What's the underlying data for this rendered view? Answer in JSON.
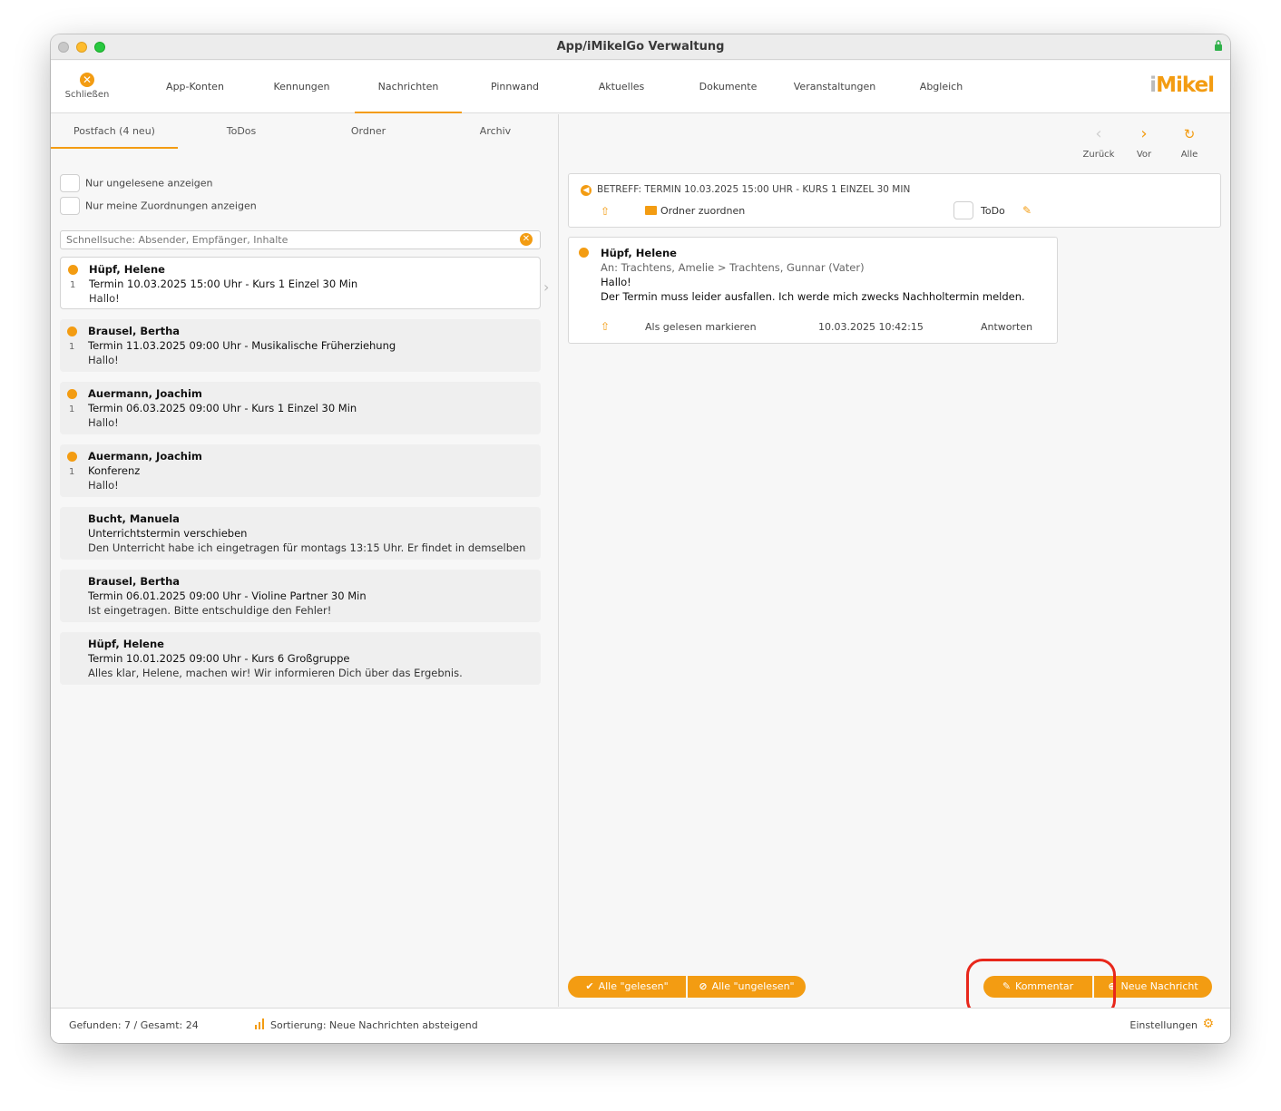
{
  "window": {
    "title": "App/iMikelGo Verwaltung"
  },
  "toolbar": {
    "close_label": "Schließen",
    "tabs": [
      {
        "label": "App-Konten"
      },
      {
        "label": "Kennungen"
      },
      {
        "label": "Nachrichten",
        "active": true
      },
      {
        "label": "Pinnwand"
      },
      {
        "label": "Aktuelles"
      },
      {
        "label": "Dokumente"
      },
      {
        "label": "Veranstaltungen"
      },
      {
        "label": "Abgleich"
      }
    ],
    "logo_i": "i",
    "logo_rest": "Mikel"
  },
  "left": {
    "subtabs": [
      {
        "label": "Postfach (4 neu)",
        "active": true
      },
      {
        "label": "ToDos"
      },
      {
        "label": "Ordner"
      },
      {
        "label": "Archiv"
      }
    ],
    "filters": {
      "unread_only": "Nur ungelesene anzeigen",
      "my_assignments": "Nur meine Zuordnungen anzeigen"
    },
    "search": {
      "placeholder": "Schnellsuche: Absender, Empfänger, Inhalte",
      "value": ""
    },
    "messages": [
      {
        "from": "Hüpf, Helene",
        "count": "1",
        "subject": "Termin 10.03.2025 15:00 Uhr - Kurs 1 Einzel 30 Min",
        "preview": "Hallo!",
        "unread": true
      },
      {
        "from": "Brausel, Bertha",
        "count": "1",
        "subject": "Termin 11.03.2025 09:00 Uhr - Musikalische Früherziehung",
        "preview": "Hallo!",
        "unread": true
      },
      {
        "from": "Auermann, Joachim",
        "count": "1",
        "subject": "Termin 06.03.2025 09:00 Uhr - Kurs 1 Einzel 30 Min",
        "preview": "Hallo!",
        "unread": true
      },
      {
        "from": "Auermann, Joachim",
        "count": "1",
        "subject": "Konferenz",
        "preview": "Hallo!",
        "unread": true
      },
      {
        "from": "Bucht, Manuela",
        "count": "",
        "subject": "Unterrichtstermin verschieben",
        "preview": "Den Unterricht habe ich eingetragen für montags 13:15 Uhr. Er findet in demselben ...",
        "unread": false
      },
      {
        "from": "Brausel, Bertha",
        "count": "",
        "subject": "Termin 06.01.2025 09:00 Uhr - Violine Partner 30 Min",
        "preview": "Ist eingetragen. Bitte entschuldige den Fehler!",
        "unread": false
      },
      {
        "from": "Hüpf, Helene",
        "count": "",
        "subject": "Termin 10.01.2025 09:00 Uhr - Kurs 6 Großgruppe",
        "preview": "Alles klar, Helene, machen wir! Wir informieren Dich über das Ergebnis.",
        "unread": false
      }
    ]
  },
  "right": {
    "nav": {
      "back": "Zurück",
      "forward": "Vor",
      "all": "Alle"
    },
    "subject": "BETREFF: TERMIN 10.03.2025 15:00 UHR - KURS 1 EINZEL 30 MIN",
    "assign_folder": "Ordner zuordnen",
    "todo": "ToDo",
    "message": {
      "from": "Hüpf, Helene",
      "to": "An: Trachtens, Amelie > Trachtens, Gunnar (Vater)",
      "body_line1": "Hallo!",
      "body_line2": "Der Termin muss leider ausfallen. Ich werde mich zwecks Nachholtermin melden.",
      "mark_read": "Als gelesen markieren",
      "date": "10.03.2025 10:42:15",
      "reply": "Antworten"
    },
    "buttons": {
      "all_read": "Alle \"gelesen\"",
      "all_unread": "Alle \"ungelesen\"",
      "comment": "Kommentar",
      "new_message": "Neue Nachricht"
    }
  },
  "status": {
    "found": "Gefunden: 7 / Gesamt: 24",
    "sort": "Sortierung: Neue Nachrichten absteigend",
    "settings": "Einstellungen"
  },
  "colors": {
    "accent": "#f39c12",
    "highlight": "#e8271b"
  },
  "icons": [
    "close-circle-icon",
    "lock-icon",
    "back-arrow-icon",
    "forward-arrow-icon",
    "refresh-icon",
    "share-icon",
    "folder-icon",
    "assign-icon",
    "check-icon",
    "eye-slash-icon",
    "edit-icon",
    "new-message-icon",
    "sort-icon",
    "gear-icon",
    "chevron-right-icon"
  ]
}
